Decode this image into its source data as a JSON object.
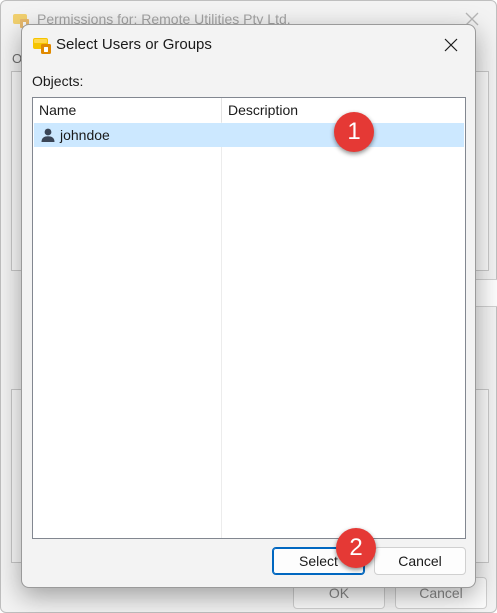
{
  "background_window": {
    "title": "Permissions for: Remote Utilities Pty Ltd.",
    "label_fragment": "O",
    "ok_label": "OK",
    "cancel_label": "Cancel"
  },
  "dialog": {
    "title": "Select Users or Groups",
    "objects_label": "Objects:",
    "columns": {
      "name": "Name",
      "description": "Description"
    },
    "rows": [
      {
        "name": "johndoe",
        "description": "",
        "icon": "user-icon",
        "selected": true
      }
    ],
    "select_label": "Select",
    "cancel_label": "Cancel"
  },
  "annotations": {
    "marker1": "1",
    "marker2": "2"
  },
  "colors": {
    "selection": "#cce8ff",
    "accent": "#0067c0",
    "marker": "#e53935"
  }
}
